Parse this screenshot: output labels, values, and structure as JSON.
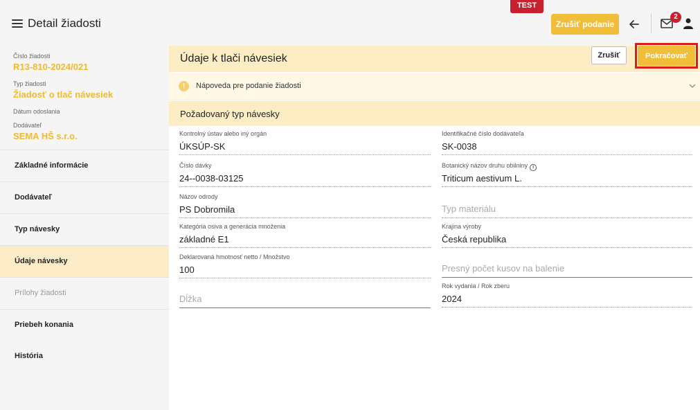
{
  "header": {
    "title": "Detail žiadosti",
    "env_badge": "TEST",
    "cancel_submission_label": "Zrušiť podanie",
    "mail_count": "2"
  },
  "sidebar": {
    "meta": [
      {
        "label": "Číslo žiadosti",
        "value": "R13-810-2024/021"
      },
      {
        "label": "Typ žiadosti",
        "value": "Žiadosť o tlač návesiek"
      },
      {
        "label": "Dátum odoslania",
        "value": ""
      },
      {
        "label": "Dodávateľ",
        "value": "SEMA HŠ s.r.o."
      }
    ],
    "items": [
      {
        "label": "Základné informácie"
      },
      {
        "label": "Dodávateľ"
      },
      {
        "label": "Typ návesky"
      },
      {
        "label": "Údaje návesky"
      },
      {
        "label": "Prílohy žiadosti"
      },
      {
        "label": "Priebeh konania"
      },
      {
        "label": "História"
      }
    ]
  },
  "main": {
    "title": "Údaje k tlači návesiek",
    "cancel_label": "Zrušiť",
    "continue_label": "Pokračovať",
    "help_text": "Nápoveda pre podanie žiadosti",
    "section_title": "Požadovaný typ návesky",
    "fields": {
      "kontrolny_ustav": {
        "label": "Kontrolný ústav alebo iný orgán",
        "value": "ÚKSÚP-SK"
      },
      "id_dodavatela": {
        "label": "Identifikačné číslo dodávateľa",
        "value": "SK-0038"
      },
      "cislo_davky": {
        "label": "Číslo dávky",
        "value": "24--0038-03125"
      },
      "botanicky_nazov": {
        "label": "Botanický názov druhu obilniny",
        "value": "Triticum aestivum L."
      },
      "nazov_odrody": {
        "label": "Názov odrody",
        "value": "PS Dobromila"
      },
      "typ_materialu": {
        "placeholder": "Typ materiálu"
      },
      "kategoria": {
        "label": "Kategória osiva a generácia množenia",
        "value": "základné E1"
      },
      "krajina": {
        "label": "Krajina výroby",
        "value": "Česká republika"
      },
      "hmotnost": {
        "label": "Deklarovaná hmotnosť netto / Množstvo",
        "value": "100"
      },
      "pocet_kusov": {
        "placeholder": "Presný počet kusov na balenie"
      },
      "dlzka": {
        "placeholder": "Dĺžka"
      },
      "rok": {
        "label": "Rok vydania / Rok zberu",
        "value": "2024"
      }
    }
  },
  "colors": {
    "accent": "#f1be3a",
    "accent_text": "#f0b92e",
    "section_bg": "#fdedc4",
    "highlight_border": "#d91c1c",
    "danger": "#c8202f"
  }
}
